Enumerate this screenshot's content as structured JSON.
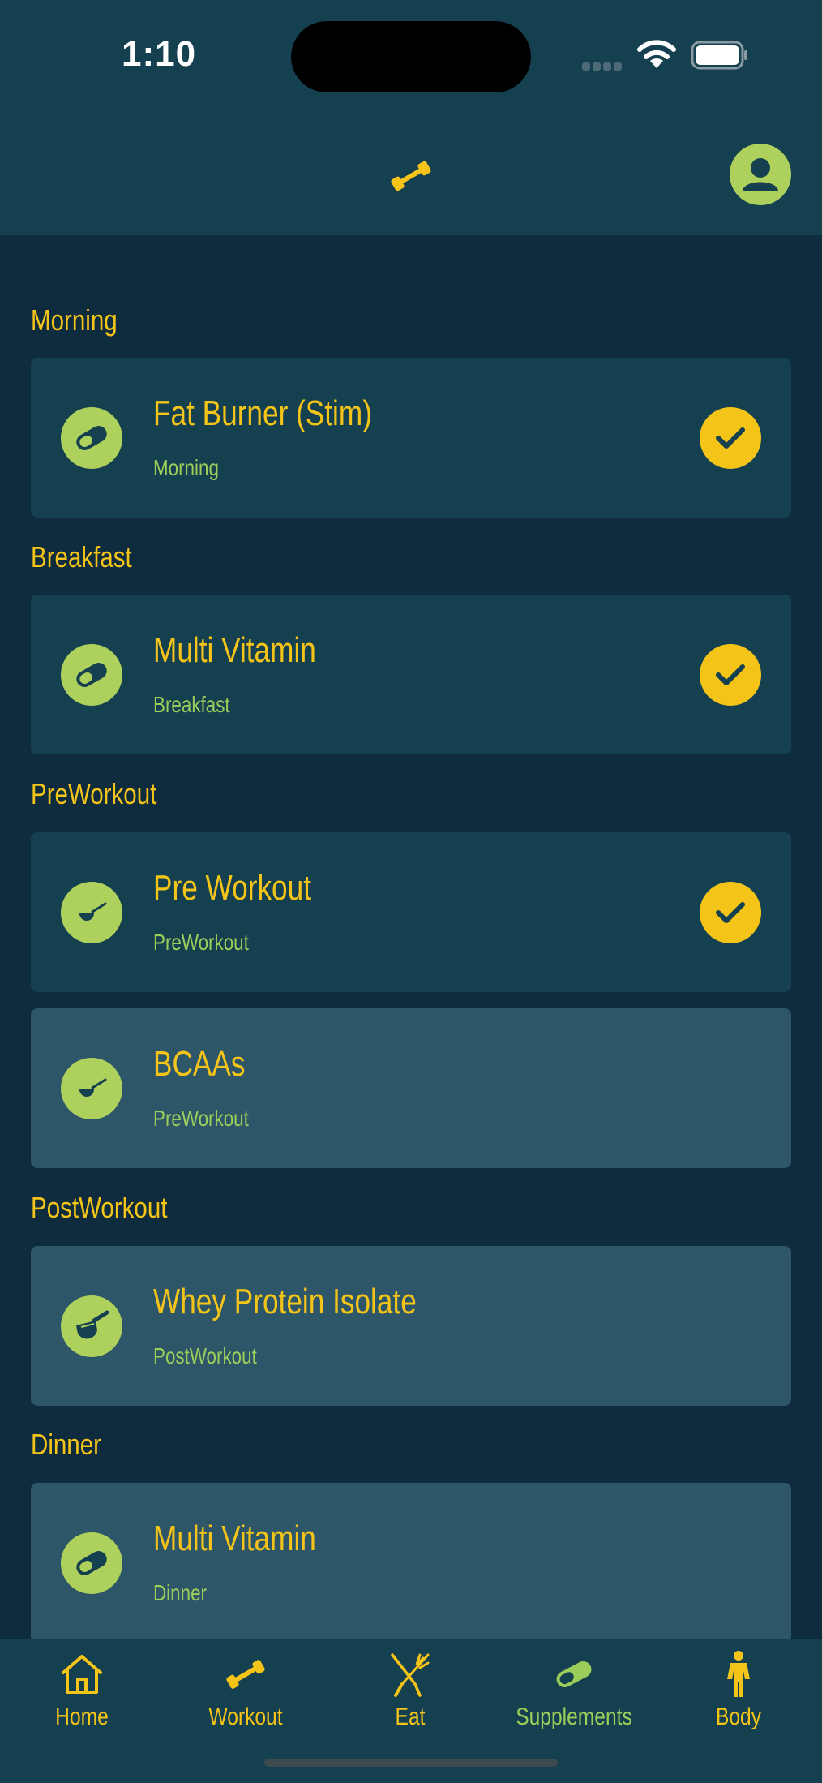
{
  "status_bar": {
    "time": "1:10"
  },
  "sections": [
    {
      "title": "Morning",
      "items": [
        {
          "name": "Fat Burner (Stim)",
          "time": "Morning",
          "icon": "capsule-icon",
          "taken": true
        }
      ]
    },
    {
      "title": "Breakfast",
      "items": [
        {
          "name": "Multi Vitamin",
          "time": "Breakfast",
          "icon": "capsule-icon",
          "taken": true
        }
      ]
    },
    {
      "title": "PreWorkout",
      "items": [
        {
          "name": "Pre Workout",
          "time": "PreWorkout",
          "icon": "scoop-icon",
          "taken": true
        },
        {
          "name": "BCAAs",
          "time": "PreWorkout",
          "icon": "scoop-icon",
          "taken": false
        }
      ]
    },
    {
      "title": "PostWorkout",
      "items": [
        {
          "name": "Whey Protein Isolate",
          "time": "PostWorkout",
          "icon": "protein-scoop-icon",
          "taken": false
        }
      ]
    },
    {
      "title": "Dinner",
      "items": [
        {
          "name": "Multi Vitamin",
          "time": "Dinner",
          "icon": "capsule-icon",
          "taken": false
        }
      ]
    }
  ],
  "tabs": [
    {
      "label": "Home",
      "icon": "home-icon"
    },
    {
      "label": "Workout",
      "icon": "dumbbell-icon"
    },
    {
      "label": "Eat",
      "icon": "utensils-icon"
    },
    {
      "label": "Supplements",
      "icon": "capsule-icon",
      "active": true
    },
    {
      "label": "Body",
      "icon": "person-icon"
    }
  ],
  "colors": {
    "background": "#0e2c3d",
    "header": "#15404f",
    "pending_card": "#2d5668",
    "accent_yellow": "#f5c419",
    "accent_green": "#add15c",
    "secondary_text": "#9ccd5b"
  }
}
